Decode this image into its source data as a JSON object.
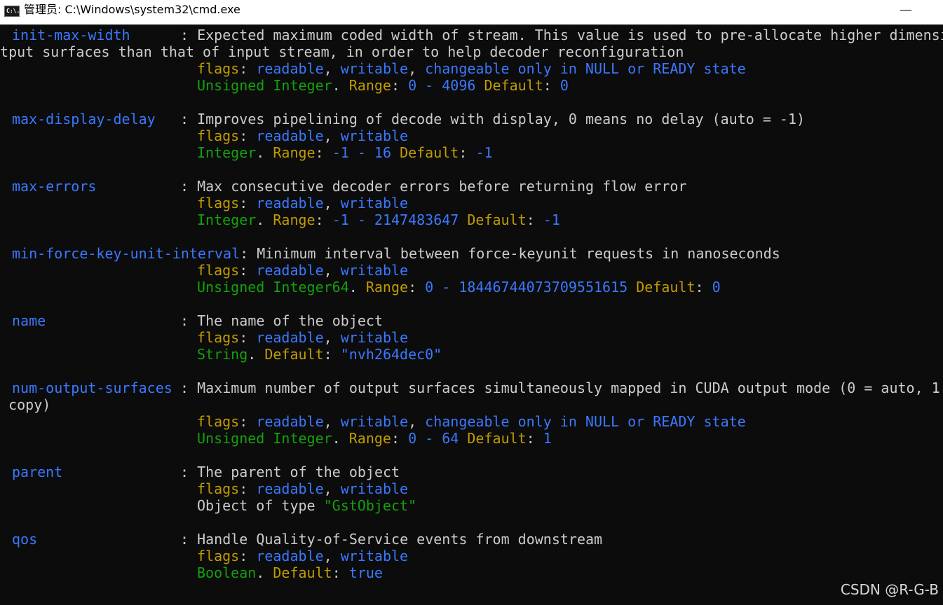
{
  "window": {
    "icon_text": "C:\\.",
    "title": "管理员: C:\\Windows\\system32\\cmd.exe"
  },
  "console": {
    "props": {
      "init_max_width": {
        "name": "init-max-width",
        "desc_1": "Expected maximum coded width of stream. This value is used to pre-allocate higher dimensi",
        "desc_2": "utput surfaces than that of input stream, in order to help decoder reconfiguration",
        "type": "Unsigned Integer",
        "range_min": "0",
        "range_max": "4096",
        "default": "0"
      },
      "max_display_delay": {
        "name": "max-display-delay",
        "desc": "Improves pipelining of decode with display, 0 means no delay (auto = -1)",
        "type": "Integer",
        "range_min": "-1",
        "range_max": "16",
        "default": "-1"
      },
      "max_errors": {
        "name": "max-errors",
        "desc": "Max consecutive decoder errors before returning flow error",
        "type": "Integer",
        "range_min": "-1",
        "range_max": "2147483647",
        "default": "-1"
      },
      "min_force": {
        "name": "min-force-key-unit-interval",
        "desc": "Minimum interval between force-keyunit requests in nanoseconds",
        "type": "Unsigned Integer64",
        "range_min": "0",
        "range_max": "18446744073709551615",
        "default": "0"
      },
      "name_prop": {
        "name": "name",
        "desc": "The name of the object",
        "type": "String",
        "default": "\"nvh264dec0\""
      },
      "num_output_surfaces": {
        "name": "num-output-surfaces",
        "desc_1": "Maximum number of output surfaces simultaneously mapped in CUDA output mode (0 = auto, 1",
        "desc_2": "s copy)",
        "type": "Unsigned Integer",
        "range_min": "0",
        "range_max": "64",
        "default": "1"
      },
      "parent": {
        "name": "parent",
        "desc": "The parent of the object",
        "object_of_type": "Object of type",
        "object_type": "\"GstObject\""
      },
      "qos": {
        "name": "qos",
        "desc": "Handle Quality-of-Service events from downstream",
        "type": "Boolean",
        "default": "true"
      }
    },
    "lbl": {
      "flags": "flags",
      "readable": "readable",
      "writable": "writable",
      "changeable": "changeable only in NULL or READY state",
      "range": "Range",
      "default": "Default"
    }
  },
  "watermark": "CSDN @R-G-B",
  "colors": {
    "background": "#0c0c0c",
    "text_default": "#cccccc",
    "property_name": "#3b78ff",
    "type_name": "#13a10e",
    "keyword": "#c19c00"
  }
}
